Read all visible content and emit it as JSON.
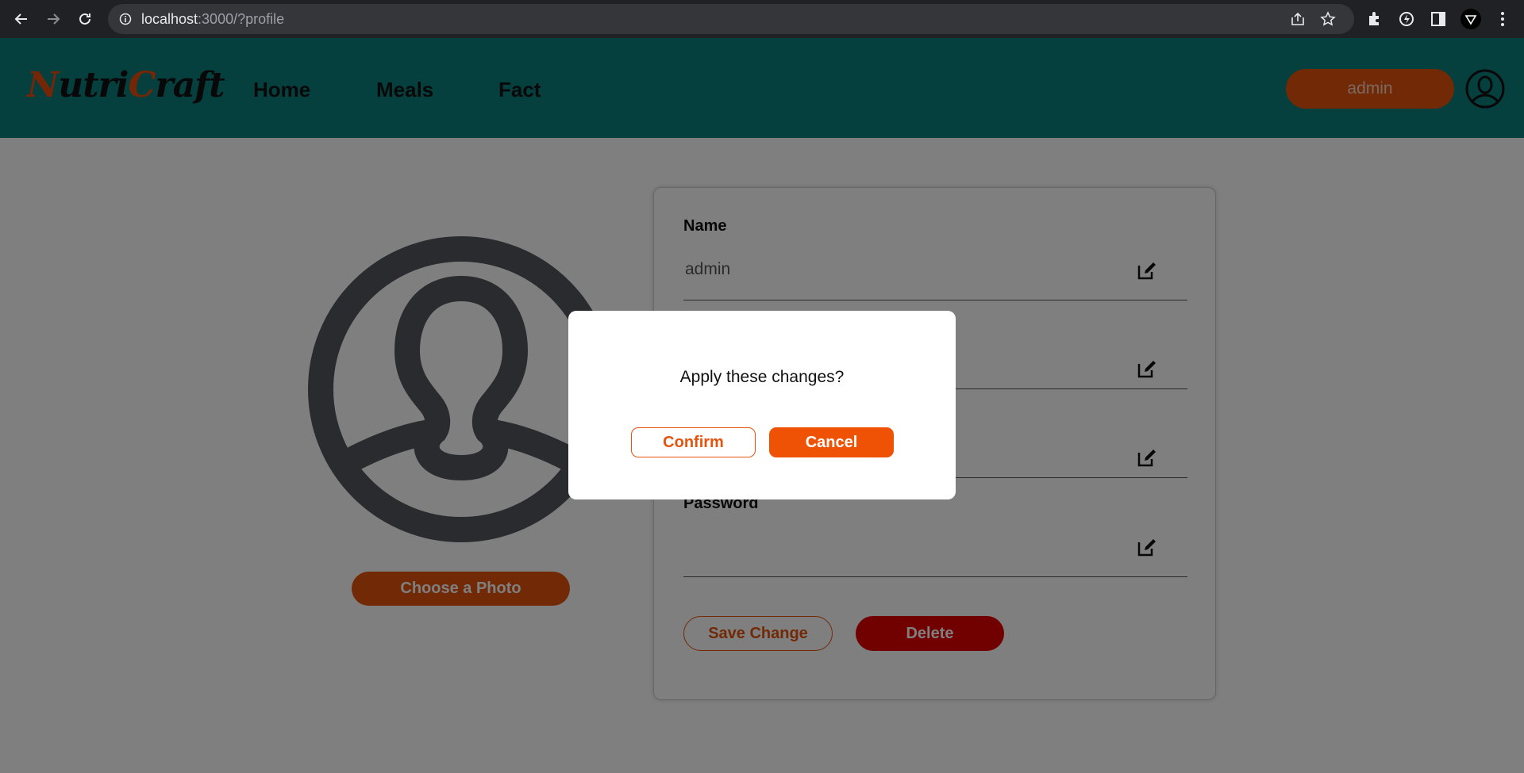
{
  "browser": {
    "url_host": "localhost",
    "url_path": ":3000/?profile",
    "icons": [
      "back-icon",
      "forward-icon",
      "reload-icon",
      "info-icon",
      "share-icon",
      "star-icon",
      "extensions-icon",
      "extension-icon",
      "sidebar-icon",
      "profile-icon",
      "menu-icon"
    ]
  },
  "header": {
    "logo": {
      "part1": "N",
      "part2": "utri",
      "part3": "C",
      "part4": "raft"
    },
    "nav": [
      {
        "label": "Home"
      },
      {
        "label": "Meals"
      },
      {
        "label": "Fact"
      }
    ],
    "user_label": "admin"
  },
  "profile": {
    "choose_photo_label": "Choose a Photo",
    "fields": [
      {
        "label": "Name",
        "value": "admin"
      },
      {
        "label": "",
        "value": ""
      },
      {
        "label": "",
        "value": ""
      },
      {
        "label": "Password",
        "value": ""
      }
    ],
    "save_label": "Save Change",
    "delete_label": "Delete"
  },
  "dialog": {
    "message": "Apply these changes?",
    "confirm_label": "Confirm",
    "cancel_label": "Cancel"
  },
  "colors": {
    "header": "#0b7f7d",
    "accent": "#e5530d",
    "danger": "#e30000",
    "overlay": "rgba(0,0,0,0.5)"
  }
}
